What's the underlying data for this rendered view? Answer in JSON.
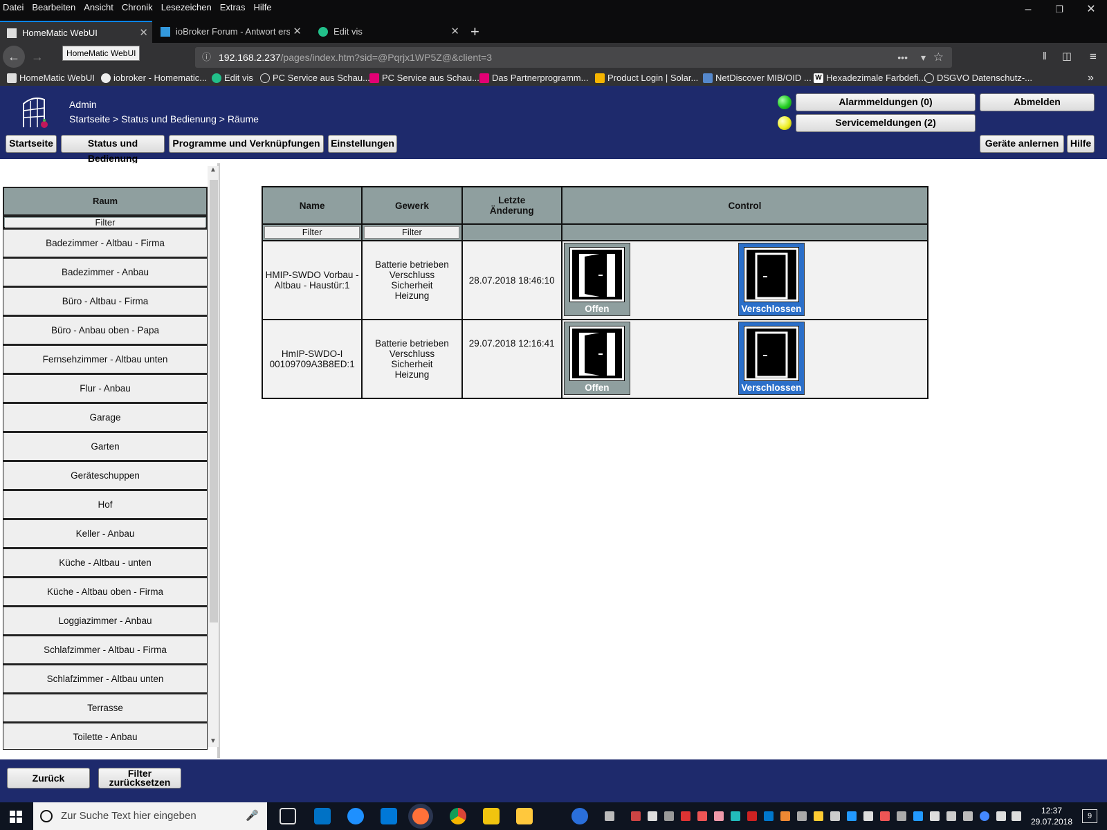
{
  "menubar": {
    "items": [
      "Datei",
      "Bearbeiten",
      "Ansicht",
      "Chronik",
      "Lesezeichen",
      "Extras",
      "Hilfe"
    ]
  },
  "tabs": [
    {
      "label": "HomeMatic WebUI",
      "active": true
    },
    {
      "label": "ioBroker Forum - Antwort erste",
      "active": false
    },
    {
      "label": "Edit vis",
      "active": false
    }
  ],
  "tooltip": "HomeMatic WebUI",
  "url": {
    "host": "192.168.2.237",
    "path": "/pages/index.htm?sid=@Pqrjx1WP5Z@&client=3"
  },
  "bookmarks": [
    "HomeMatic WebUI",
    "iobroker - Homematic...",
    "Edit vis",
    "PC Service aus Schau...",
    "PC Service aus Schau...",
    "Das Partnerprogramm...",
    "Product Login | Solar...",
    "NetDiscover MIB/OID ...",
    "Hexadezimale Farbdefi...",
    "DSGVO Datenschutz-..."
  ],
  "header": {
    "user": "Admin",
    "breadcrumb": "Startseite > Status und Bedienung > Räume",
    "alarm_label": "Alarmmeldungen (0)",
    "service_label": "Servicemeldungen (2)",
    "logout_label": "Abmelden",
    "nav": [
      "Startseite",
      "Status und Bedienung",
      "Programme und Verknüpfungen",
      "Einstellungen"
    ],
    "teach_label": "Geräte anlernen",
    "help_label": "Hilfe",
    "led_colors": {
      "alarm": "#22cc22",
      "service": "#eeee22"
    }
  },
  "rooms": {
    "header": "Raum",
    "filter": "Filter",
    "items": [
      "Badezimmer - Altbau - Firma",
      "Badezimmer - Anbau",
      "Büro - Altbau - Firma",
      "Büro - Anbau oben - Papa",
      "Fernsehzimmer - Altbau unten",
      "Flur - Anbau",
      "Garage",
      "Garten",
      "Geräteschuppen",
      "Hof",
      "Keller - Anbau",
      "Küche - Altbau - unten",
      "Küche - Altbau oben - Firma",
      "Loggiazimmer - Anbau",
      "Schlafzimmer - Altbau - Firma",
      "Schlafzimmer - Altbau unten",
      "Terrasse",
      "Toilette - Anbau"
    ]
  },
  "device_table": {
    "columns": [
      "Name",
      "Gewerk",
      "Letzte\nÄnderung",
      "Control"
    ],
    "filter": "Filter",
    "rows": [
      {
        "name": "HMIP-SWDO Vorbau - Altbau - Haustür:1",
        "gewerk": [
          "Batterie betrieben",
          "Verschluss",
          "Sicherheit",
          "Heizung"
        ],
        "changed": "28.07.2018 18:46:10",
        "open_label": "Offen",
        "closed_label": "Verschlossen"
      },
      {
        "name": "HmIP-SWDO-I 00109709A3B8ED:1",
        "gewerk": [
          "Batterie betrieben",
          "Verschluss",
          "Sicherheit",
          "Heizung"
        ],
        "changed": "29.07.2018 12:16:41",
        "open_label": "Offen",
        "closed_label": "Verschlossen"
      }
    ]
  },
  "footer": {
    "back_label": "Zurück",
    "reset_label_1": "Filter",
    "reset_label_2": "zurücksetzen"
  },
  "taskbar": {
    "search_placeholder": "Zur Suche Text hier eingeben",
    "time": "12:37",
    "date": "29.07.2018",
    "notif_count": "9"
  },
  "colors": {
    "hm_blue": "#1e2a6c",
    "hm_grey": "#8f9f9f",
    "active_blue": "#2b6fc9"
  }
}
